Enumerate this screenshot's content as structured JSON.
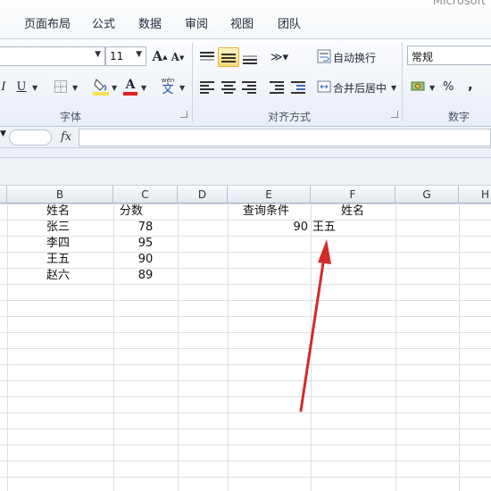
{
  "app_title": "Microsoft",
  "tabs": [
    "页面布局",
    "公式",
    "数据",
    "审阅",
    "视图",
    "团队"
  ],
  "ribbon": {
    "font_size": "11",
    "grow_font": "A",
    "shrink_font": "A",
    "italic": "I",
    "underline": "U",
    "font_color_glyph": "A",
    "wen_glyph": "wén",
    "wen_char": "文",
    "wrap_text": "自动换行",
    "merge_center": "合并后居中",
    "number_format": "常规",
    "percent": "%",
    "comma": ",",
    "group_font": "字体",
    "group_alignment": "对齐方式",
    "group_number": "数字",
    "fill_color": "#f5e04a",
    "font_color": "#e02020"
  },
  "formula_bar": {
    "fx": "fx",
    "value": ""
  },
  "columns": [
    "B",
    "C",
    "D",
    "E",
    "F",
    "G",
    "H"
  ],
  "table": {
    "headers": {
      "name": "姓名",
      "score": "分数",
      "query_label": "查询条件",
      "result_label": "姓名"
    },
    "rows": [
      {
        "name": "张三",
        "score": "78"
      },
      {
        "name": "李四",
        "score": "95"
      },
      {
        "name": "王五",
        "score": "90"
      },
      {
        "name": "赵六",
        "score": "89"
      }
    ],
    "query_value": "90",
    "result_value": "王五"
  },
  "annotation": {
    "arrow_color": "#d42a2a"
  }
}
